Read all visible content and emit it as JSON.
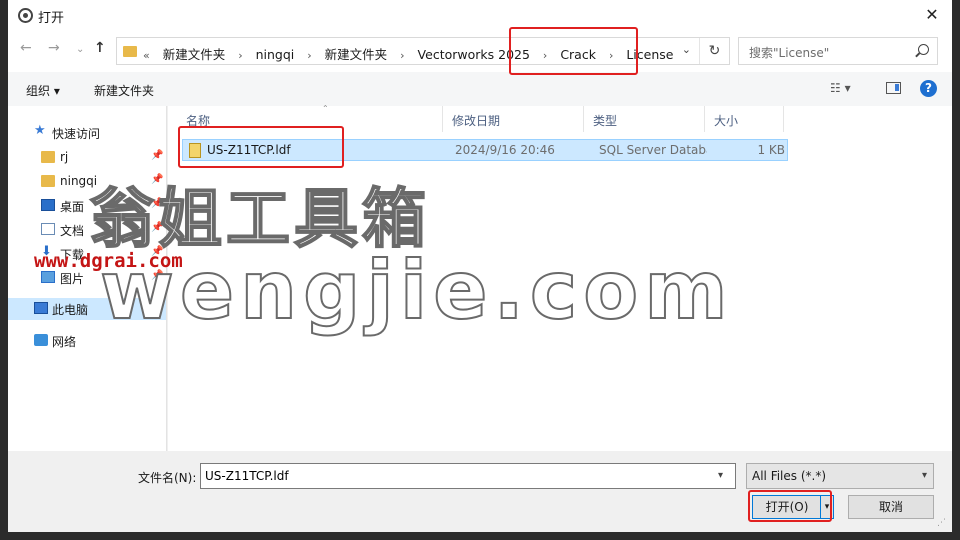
{
  "window": {
    "title": "打开",
    "close_glyph": "✕"
  },
  "nav": {
    "back_glyph": "←",
    "forward_glyph": "→",
    "recent_glyph": "⌄",
    "up_glyph": "↑",
    "crumbs_prefix": "«",
    "crumbs": [
      "新建文件夹",
      "ningqi",
      "新建文件夹",
      "Vectorworks 2025",
      "Crack",
      "License"
    ],
    "crumb_sep": "›",
    "dropdown_glyph": "⌄",
    "refresh_glyph": "↻",
    "search_placeholder": "搜索\"License\""
  },
  "toolbar": {
    "organize": "组织 ▾",
    "new_folder": "新建文件夹",
    "view_glyph": "☷ ▾",
    "help": "?"
  },
  "sidebar": {
    "items": [
      {
        "label": "快速访问",
        "icon": "star-icon"
      },
      {
        "label": "rj",
        "icon": "folder-icon",
        "pinned": true
      },
      {
        "label": "ningqi",
        "icon": "folder-icon",
        "pinned": true
      },
      {
        "label": "桌面",
        "icon": "desktop-icon",
        "pinned": true
      },
      {
        "label": "文档",
        "icon": "document-icon",
        "pinned": true
      },
      {
        "label": "下载",
        "icon": "download-icon",
        "pinned": true
      },
      {
        "label": "图片",
        "icon": "picture-icon",
        "pinned": true
      },
      {
        "label": "此电脑",
        "icon": "computer-icon"
      },
      {
        "label": "网络",
        "icon": "network-icon"
      }
    ],
    "pin_glyph": "📌"
  },
  "columns": {
    "name": "名称",
    "date": "修改日期",
    "type": "类型",
    "size": "大小"
  },
  "files": [
    {
      "name": "US-Z11TCP.ldf",
      "date": "2024/9/16 20:46",
      "type": "SQL Server Database Transaction Log",
      "size": "1 KB"
    }
  ],
  "bottom": {
    "filename_label": "文件名(N):",
    "filename_value": "US-Z11TCP.ldf",
    "filetype": "All Files (*.*)",
    "open": "打开(O)",
    "cancel": "取消"
  },
  "watermark": {
    "cn": "翁姐工具箱",
    "en": "wengjie.com",
    "url": "www.dgrai.com"
  },
  "colors": {
    "highlight": "#e02020",
    "selection": "#cce8ff",
    "accent": "#0078d7"
  }
}
